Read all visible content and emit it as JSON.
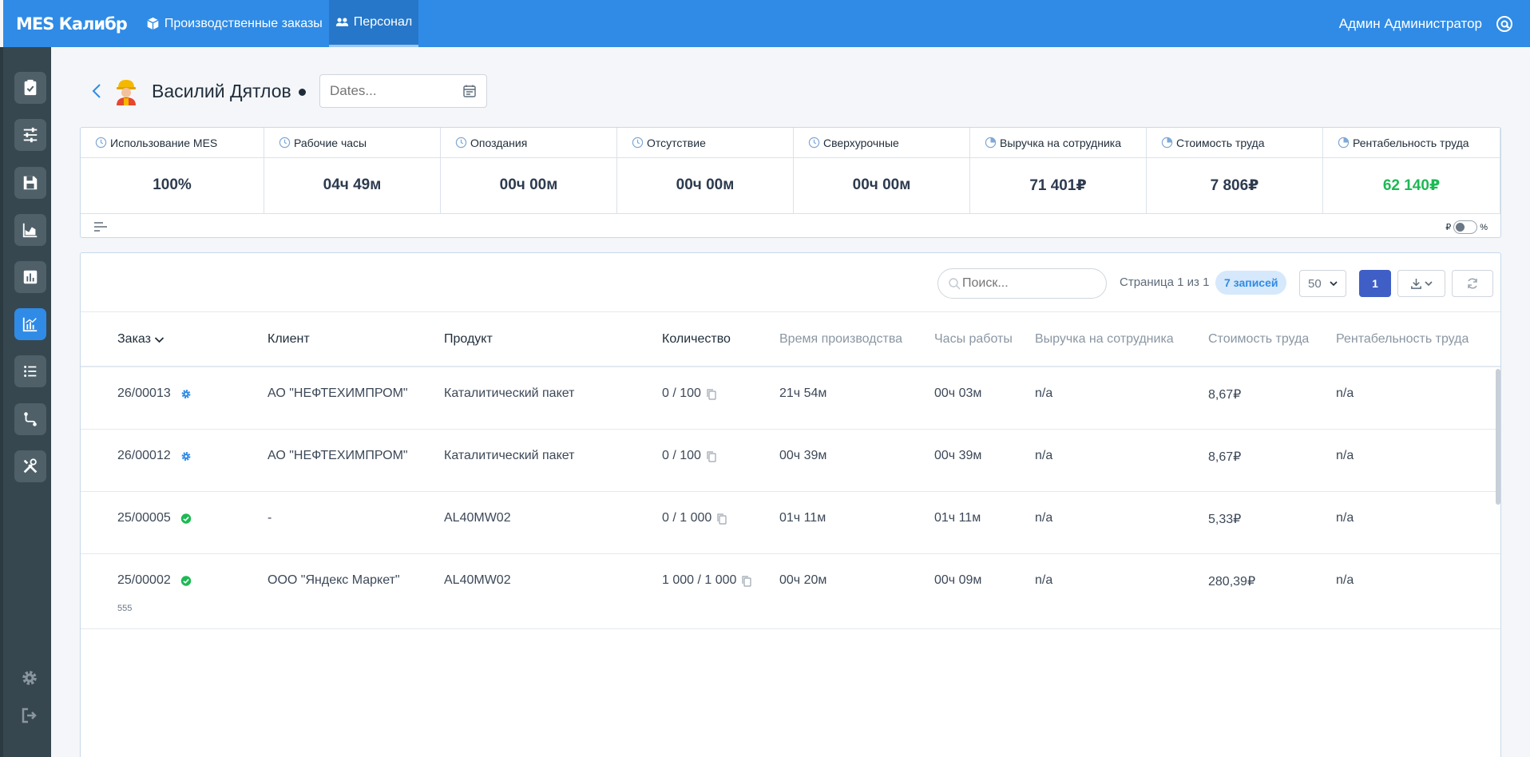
{
  "app": {
    "brand": "MES Калибр",
    "nav": [
      {
        "label": "Производственные заказы",
        "icon": "cubes-icon"
      },
      {
        "label": "Персонал",
        "icon": "users-icon"
      }
    ],
    "user_name": "Админ Администратор"
  },
  "sidebar": {
    "items": [
      "clipboard-check-icon",
      "sliders-icon",
      "save-icon",
      "area-chart-icon",
      "bar-chart-icon",
      "line-chart-icon",
      "list-icon",
      "route-icon",
      "tools-icon"
    ],
    "active_index": 5,
    "bottom": [
      "gear-icon",
      "logout-icon"
    ]
  },
  "header": {
    "person_name": "Василий Дятлов",
    "date_placeholder": "Dates..."
  },
  "kpis": [
    {
      "label": "Использование MES",
      "value": "100%"
    },
    {
      "label": "Рабочие часы",
      "value": "04ч 49м"
    },
    {
      "label": "Опоздания",
      "value": "00ч 00м"
    },
    {
      "label": "Отсутствие",
      "value": "00ч 00м"
    },
    {
      "label": "Сверхурочные",
      "value": "00ч 00м"
    },
    {
      "label": "Выручка на сотрудника",
      "value": "71 401₽"
    },
    {
      "label": "Стоимость труда",
      "value": "7 806₽"
    },
    {
      "label": "Рентабельность труда",
      "value": "62 140₽"
    }
  ],
  "kpi_toggle": {
    "left": "₽",
    "right": "%"
  },
  "colors": {
    "accent": "#2f8be6",
    "positive": "#1db954",
    "sidebar": "#37474f"
  },
  "table": {
    "search_placeholder": "Поиск...",
    "page_info": "Страница 1 из 1",
    "records": "7 записей",
    "per_page": "50",
    "current_page": "1",
    "columns": [
      "Заказ",
      "Клиент",
      "Продукт",
      "Количество",
      "Время производства",
      "Часы работы",
      "Выручка на сотрудника",
      "Стоимость труда",
      "Рентабельность труда"
    ],
    "rows": [
      {
        "order": "26/00013",
        "status": "in-progress",
        "client": "АО \"НЕФТЕХИМПРОМ\"",
        "product": "Каталитический пакет",
        "qty": "0 / 100",
        "prod_time": "21ч 54м",
        "work_hours": "00ч 03м",
        "revenue": "n/a",
        "labor_cost": "8,67₽",
        "profitability": "n/a",
        "note": ""
      },
      {
        "order": "26/00012",
        "status": "in-progress",
        "client": "АО \"НЕФТЕХИМПРОМ\"",
        "product": "Каталитический пакет",
        "qty": "0 / 100",
        "prod_time": "00ч 39м",
        "work_hours": "00ч 39м",
        "revenue": "n/a",
        "labor_cost": "8,67₽",
        "profitability": "n/a",
        "note": ""
      },
      {
        "order": "25/00005",
        "status": "done",
        "client": "-",
        "product": "AL40MW02",
        "qty": "0 / 1 000",
        "prod_time": "01ч 11м",
        "work_hours": "01ч 11м",
        "revenue": "n/a",
        "labor_cost": "5,33₽",
        "profitability": "n/a",
        "note": ""
      },
      {
        "order": "25/00002",
        "status": "done",
        "client": "ООО \"Яндекс Маркет\"",
        "product": "AL40MW02",
        "qty": "1 000 / 1 000",
        "prod_time": "00ч 20м",
        "work_hours": "00ч 09м",
        "revenue": "n/a",
        "labor_cost": "280,39₽",
        "profitability": "n/a",
        "note": "555"
      }
    ]
  }
}
